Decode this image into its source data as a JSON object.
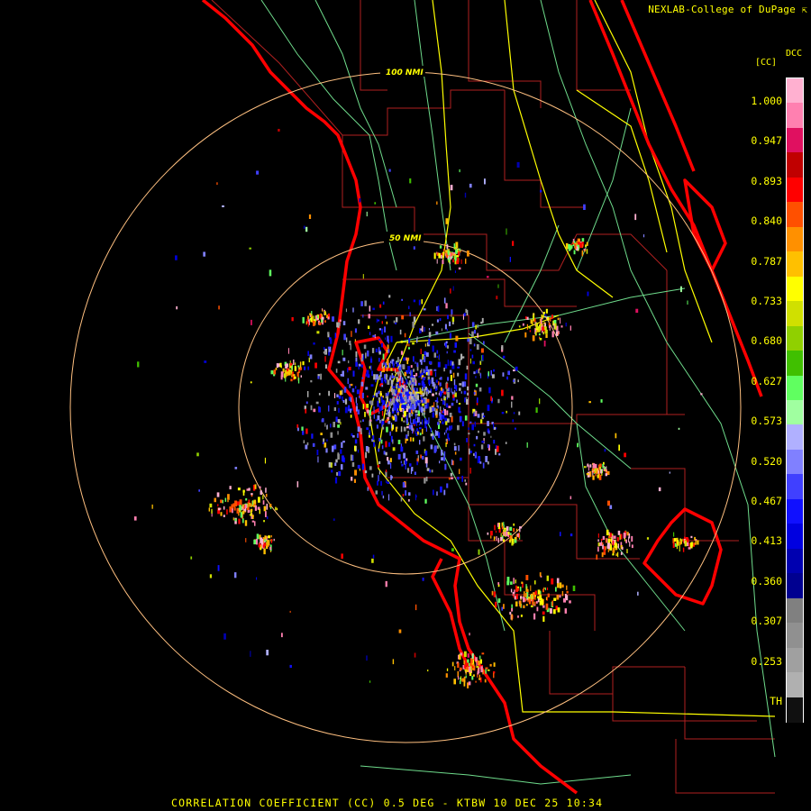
{
  "credit": "NEXLAB-College of DuPage",
  "product_code": "DCC",
  "unit_label": "[CC]",
  "footer": "CORRELATION COEFFICIENT (CC) 0.5 DEG - KTBW 10 DEC 25 10:34",
  "range_rings": [
    {
      "label": "50 NMI",
      "nmi": 50
    },
    {
      "label": "100 NMI",
      "nmi": 100
    }
  ],
  "legend_ticks": [
    "1.000",
    "0.947",
    "0.893",
    "0.840",
    "0.787",
    "0.733",
    "0.680",
    "0.627",
    "0.573",
    "0.520",
    "0.467",
    "0.413",
    "0.360",
    "0.307",
    "0.253",
    "TH"
  ],
  "legend_colors": [
    "#ffb0d0",
    "#ff80b0",
    "#e01060",
    "#c00000",
    "#ff0000",
    "#ff5000",
    "#ff9000",
    "#ffc000",
    "#ffff00",
    "#d0e000",
    "#90d000",
    "#40c000",
    "#60ff60",
    "#a0ffa0",
    "#b0b0ff",
    "#8080ff",
    "#4040ff",
    "#1010ff",
    "#0000e0",
    "#0000b0",
    "#000090",
    "#808080",
    "#909090",
    "#a0a0a0",
    "#b0b0b0",
    "#101010"
  ],
  "colors": {
    "coast": "#ff0000",
    "county": "#b02020",
    "highway": "#ffff00",
    "road": "#6fdc8c",
    "ring": "#ffc080",
    "text": "#ffff00"
  }
}
